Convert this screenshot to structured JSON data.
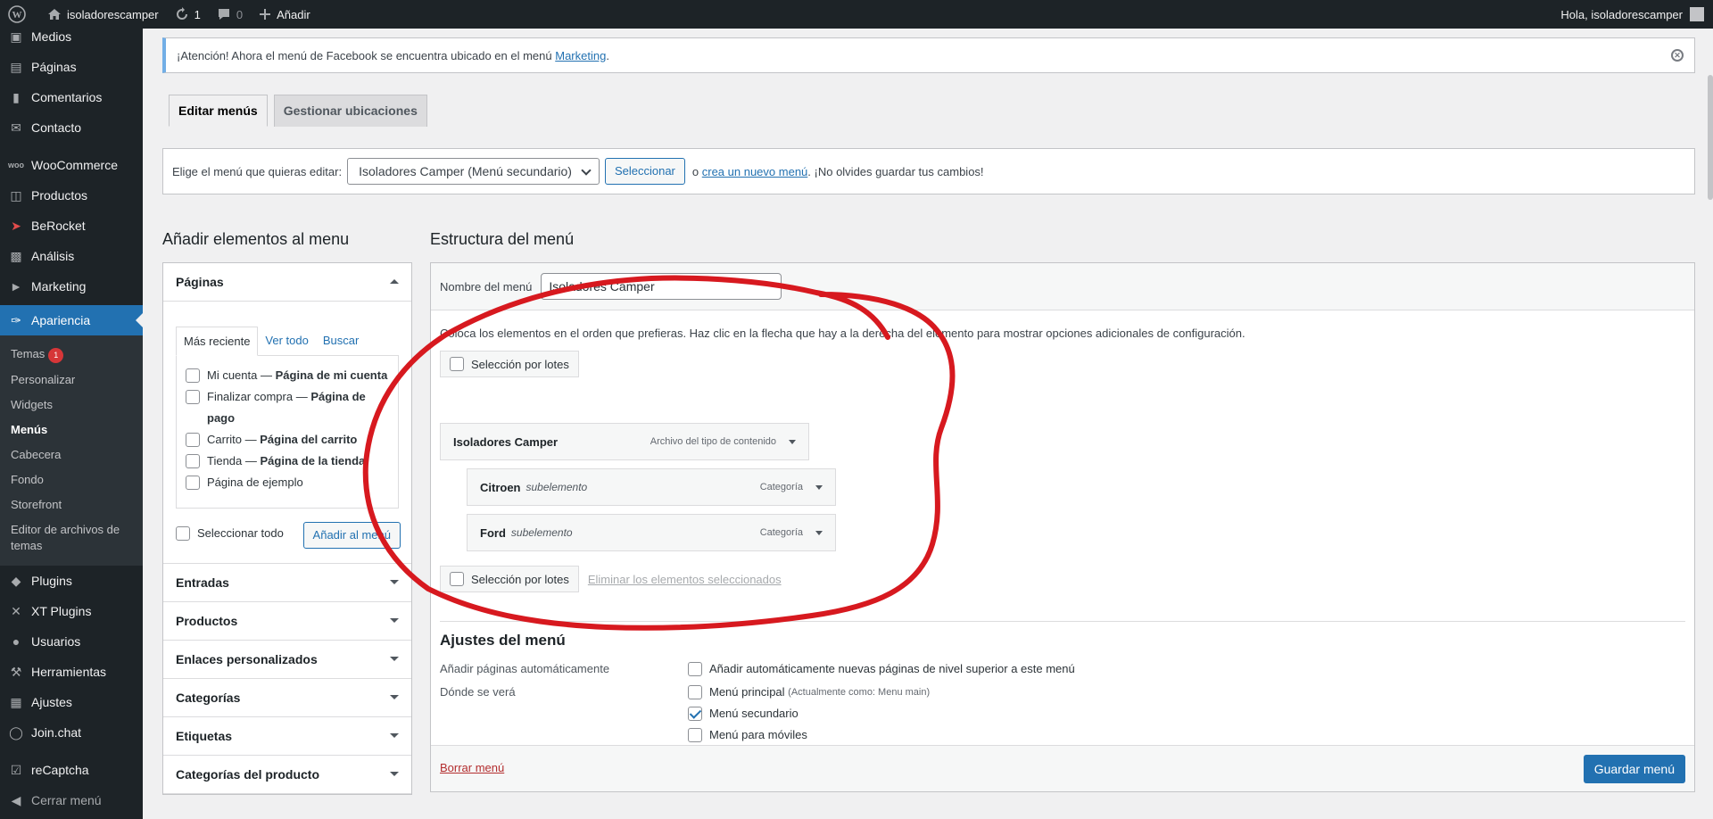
{
  "adminbar": {
    "site_name": "isoladorescamper",
    "updates_count": "1",
    "comments_count": "0",
    "new_label": "Añadir",
    "greeting": "Hola, isoladorescamper"
  },
  "sidebar": {
    "items_top": [
      {
        "label": "Medios",
        "icon": "media-icon"
      },
      {
        "label": "Páginas",
        "icon": "pages-icon"
      },
      {
        "label": "Comentarios",
        "icon": "comments-icon"
      },
      {
        "label": "Contacto",
        "icon": "mail-icon"
      },
      {
        "label": "WooCommerce",
        "icon": "woo-icon"
      },
      {
        "label": "Productos",
        "icon": "products-icon"
      },
      {
        "label": "BeRocket",
        "icon": "rocket-icon"
      },
      {
        "label": "Análisis",
        "icon": "analytics-icon"
      },
      {
        "label": "Marketing",
        "icon": "megaphone-icon"
      }
    ],
    "active": {
      "label": "Apariencia",
      "icon": "brush-icon"
    },
    "submenu": [
      {
        "label": "Temas",
        "badge": "1"
      },
      {
        "label": "Personalizar"
      },
      {
        "label": "Widgets"
      },
      {
        "label": "Menús"
      },
      {
        "label": "Cabecera"
      },
      {
        "label": "Fondo"
      },
      {
        "label": "Storefront"
      },
      {
        "label": "Editor de archivos de temas"
      }
    ],
    "items_bottom": [
      {
        "label": "Plugins",
        "icon": "plugins-icon"
      },
      {
        "label": "XT Plugins",
        "icon": "xt-icon"
      },
      {
        "label": "Usuarios",
        "icon": "users-icon"
      },
      {
        "label": "Herramientas",
        "icon": "tools-icon"
      },
      {
        "label": "Ajustes",
        "icon": "settings-icon"
      },
      {
        "label": "Join.chat",
        "icon": "chat-icon"
      },
      {
        "label": "reCaptcha",
        "icon": "captcha-icon"
      },
      {
        "label": "Cerrar menú",
        "icon": "collapse-icon"
      }
    ]
  },
  "notice": {
    "text": "¡Atención! Ahora el menú de Facebook se encuentra ubicado en el menú",
    "link": "Marketing",
    "end": "."
  },
  "tabs": [
    "Editar menús",
    "Gestionar ubicaciones"
  ],
  "manage": {
    "label": "Elige el menú que quieras editar:",
    "selected_menu": "Isoladores Camper (Menú secundario)",
    "select_button": "Seleccionar",
    "or": "o",
    "create_link": "crea un nuevo menú",
    "reminder": ". ¡No olvides guardar tus cambios!"
  },
  "left": {
    "title": "Añadir elementos al menu",
    "pages_heading": "Páginas",
    "inner_tabs": [
      "Más reciente",
      "Ver todo",
      "Buscar"
    ],
    "pages": [
      {
        "name": "Mi cuenta",
        "sep": " — ",
        "type": "Página de mi cuenta"
      },
      {
        "name": "Finalizar compra",
        "sep": " — ",
        "type": "Página de pago"
      },
      {
        "name": "Carrito",
        "sep": " — ",
        "type": "Página del carrito"
      },
      {
        "name": "Tienda",
        "sep": " — ",
        "type": "Página de la tienda"
      },
      {
        "name": "Página de ejemplo",
        "sep": "",
        "type": ""
      }
    ],
    "select_all": "Seleccionar todo",
    "add_button": "Añadir al menú",
    "sections": [
      "Entradas",
      "Productos",
      "Enlaces personalizados",
      "Categorías",
      "Etiquetas",
      "Categorías del producto"
    ]
  },
  "right": {
    "title": "Estructura del menú",
    "name_label": "Nombre del menú",
    "name_value": "Isoladores Camper",
    "instructions": "Coloca los elementos en el orden que prefieras. Haz clic en la flecha que hay a la derecha del elemento para mostrar opciones adicionales de configuración.",
    "bulk_label": "Selección por lotes",
    "items": [
      {
        "title": "Isoladores Camper",
        "sub": "",
        "type": "Archivo del tipo de contenido"
      },
      {
        "title": "Citroen",
        "sub": "subelemento",
        "type": "Categoría"
      },
      {
        "title": "Ford",
        "sub": "subelemento",
        "type": "Categoría"
      }
    ],
    "delete_selected": "Eliminar los elementos seleccionados",
    "settings_title": "Ajustes del menú",
    "auto_add_label": "Añadir páginas automáticamente",
    "auto_add_option": "Añadir automáticamente nuevas páginas de nivel superior a este menú",
    "locations_label": "Dónde se verá",
    "locations": [
      {
        "label": "Menú principal",
        "note": "(Actualmente como: Menu main)",
        "checked": false
      },
      {
        "label": "Menú secundario",
        "note": "",
        "checked": true
      },
      {
        "label": "Menú para móviles",
        "note": "",
        "checked": false
      }
    ],
    "delete_menu": "Borrar menú",
    "save_button": "Guardar menú"
  },
  "colors": {
    "accent": "#2271b1",
    "sidebar": "#1d2327",
    "annotation": "#d7191f"
  }
}
